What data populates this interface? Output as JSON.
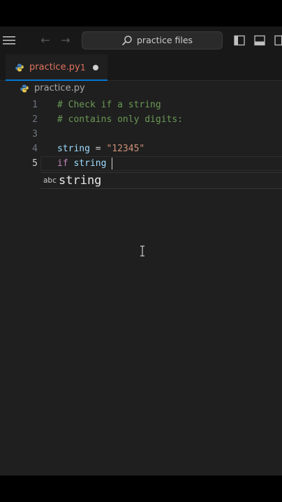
{
  "titlebar": {
    "search_text": "practice files",
    "icons": [
      "menu-icon",
      "arrow-left-icon",
      "arrow-right-icon",
      "search-icon",
      "toggle-sidebar-icon",
      "toggle-panel-icon",
      "toggle-secondary-sidebar-icon"
    ]
  },
  "tab": {
    "filename": "practice.py",
    "problem_count": "1",
    "unsaved": true,
    "icon": "python-icon"
  },
  "breadcrumb": {
    "file": "practice.py"
  },
  "editor": {
    "lines": [
      {
        "number": "1",
        "text": "# Check if a string"
      },
      {
        "number": "2",
        "text": "# contains only digits:"
      },
      {
        "number": "3",
        "text": ""
      },
      {
        "number": "4",
        "text": "string = \"12345\""
      },
      {
        "number": "5",
        "text": "if string"
      }
    ],
    "active_line": "5",
    "tokens": {
      "l1": "# Check if a string",
      "l2": "# contains only digits:",
      "l4_var": "string",
      "l4_op": " = ",
      "l4_str": "\"12345\"",
      "l5_kw": "if",
      "l5_var": " string"
    }
  },
  "suggest": {
    "kind": "abc",
    "label": "string"
  },
  "colors": {
    "accent": "#0078d4",
    "modified_tab": "#e0725e",
    "comment": "#6a9955",
    "string": "#ce9178",
    "keyword": "#c586c0"
  }
}
